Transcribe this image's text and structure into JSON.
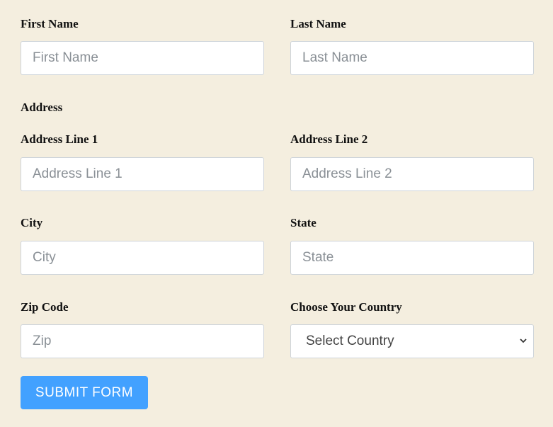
{
  "form": {
    "first_name": {
      "label": "First Name",
      "placeholder": "First Name"
    },
    "last_name": {
      "label": "Last Name",
      "placeholder": "Last Name"
    },
    "address_heading": "Address",
    "address_line1": {
      "label": "Address Line 1",
      "placeholder": "Address Line 1"
    },
    "address_line2": {
      "label": "Address Line 2",
      "placeholder": "Address Line 2"
    },
    "city": {
      "label": "City",
      "placeholder": "City"
    },
    "state": {
      "label": "State",
      "placeholder": "State"
    },
    "zip": {
      "label": "Zip Code",
      "placeholder": "Zip"
    },
    "country": {
      "label": "Choose Your Country",
      "selected": "Select Country",
      "icon": "chevron-down-icon"
    },
    "submit_label": "SUBMIT FORM"
  },
  "colors": {
    "background": "#f4eedf",
    "button": "#42a1ff"
  }
}
